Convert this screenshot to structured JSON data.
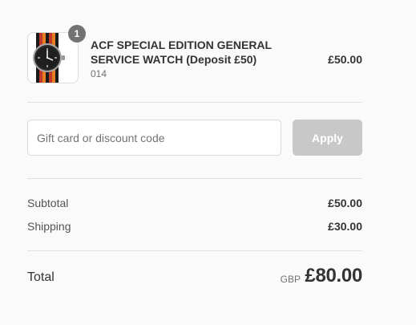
{
  "product": {
    "name": "ACF SPECIAL EDITION GENERAL SERVICE WATCH (Deposit £50)",
    "variant": "014",
    "price": "£50.00",
    "quantity": "1",
    "image_icon": "wristwatch-icon"
  },
  "discount": {
    "placeholder": "Gift card or discount code",
    "value": "",
    "apply_label": "Apply"
  },
  "summary": {
    "subtotal_label": "Subtotal",
    "subtotal_value": "£50.00",
    "shipping_label": "Shipping",
    "shipping_value": "£30.00",
    "total_label": "Total",
    "currency": "GBP",
    "total_value": "£80.00"
  },
  "colors": {
    "background": "#fafafa",
    "badge": "#727272",
    "apply_disabled": "#c8c8c8",
    "divider": "#e1e1e1"
  }
}
